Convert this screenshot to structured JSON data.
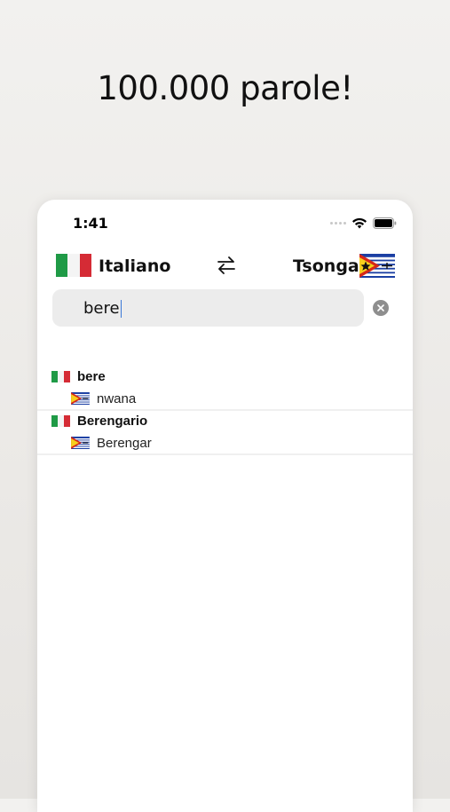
{
  "headline": "100.000 parole!",
  "status": {
    "time": "1:41"
  },
  "languages": {
    "source": {
      "label": "Italiano",
      "flag": "italy-flag"
    },
    "target": {
      "label": "Tsonga",
      "flag": "tsonga-flag"
    }
  },
  "search": {
    "value": "bere"
  },
  "results": [
    {
      "source": "bere",
      "translation": "nwana"
    },
    {
      "source": "Berengario",
      "translation": "Berengar"
    }
  ],
  "colors": {
    "italy_green": "#1f9a46",
    "italy_red": "#d52b35",
    "caret_blue": "#3a78d8"
  }
}
